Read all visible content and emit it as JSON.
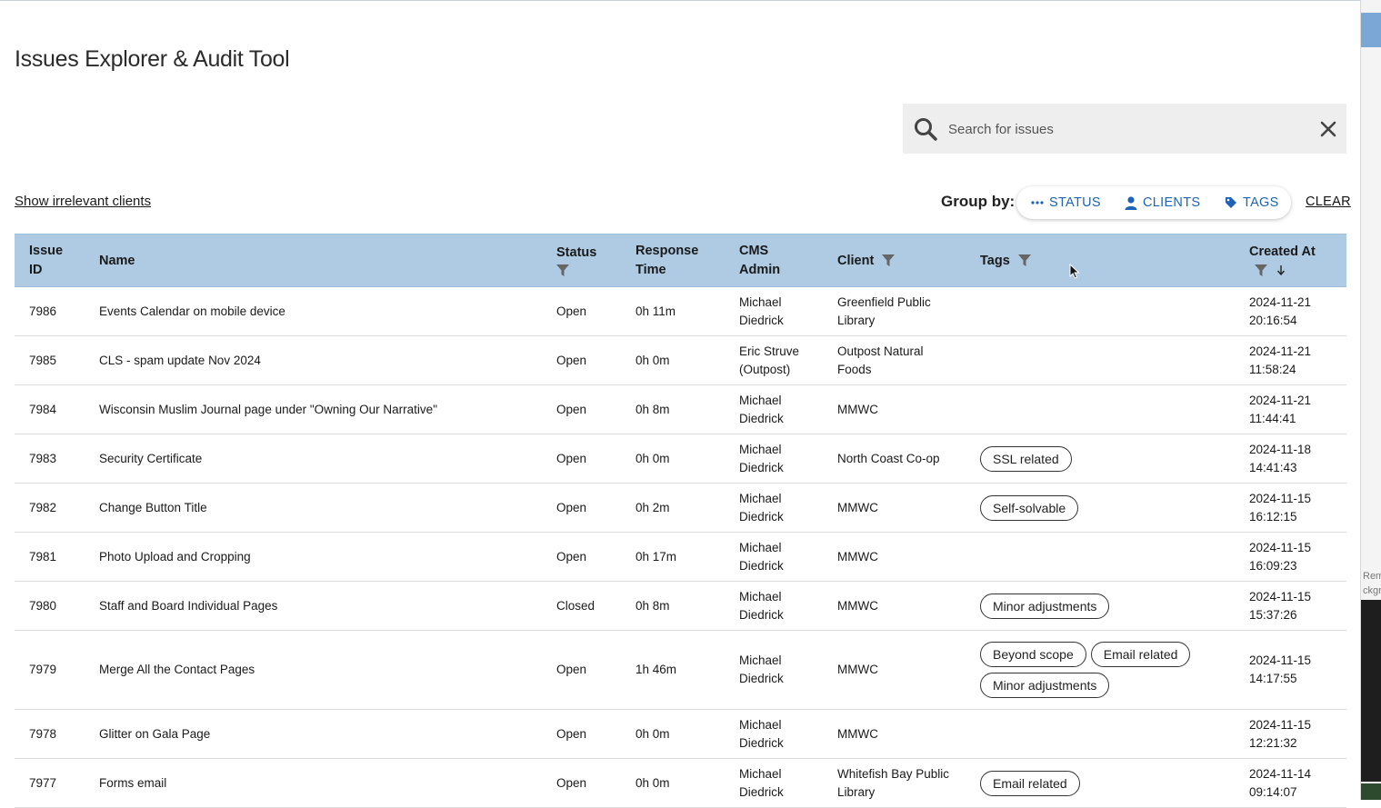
{
  "page": {
    "title": "Issues Explorer & Audit Tool",
    "show_irrelevant_label": "Show irrelevant clients",
    "group_by_label": "Group by:",
    "clear_label": "CLEAR"
  },
  "search": {
    "placeholder": "Search for issues",
    "value": ""
  },
  "group_by": {
    "status_label": "STATUS",
    "clients_label": "CLIENTS",
    "tags_label": "TAGS"
  },
  "table": {
    "headers": {
      "issue_id": "Issue ID",
      "name": "Name",
      "status": "Status",
      "response_time": "Response Time",
      "cms_admin": "CMS Admin",
      "client": "Client",
      "tags": "Tags",
      "created_at": "Created At"
    },
    "rows": [
      {
        "id": "7986",
        "name": "Events Calendar on mobile device",
        "status": "Open",
        "response": "0h 11m",
        "admin_line1": "Michael",
        "admin_line2": "Diedrick",
        "client_line1": "Greenfield Public",
        "client_line2": "Library",
        "tags": [],
        "date": "2024-11-21",
        "time": "20:16:54"
      },
      {
        "id": "7985",
        "name": "CLS - spam update Nov 2024",
        "status": "Open",
        "response": "0h 0m",
        "admin_line1": "Eric Struve",
        "admin_line2": "(Outpost)",
        "client_line1": "Outpost Natural",
        "client_line2": "Foods",
        "tags": [],
        "date": "2024-11-21",
        "time": "11:58:24"
      },
      {
        "id": "7984",
        "name": "Wisconsin Muslim Journal page under \"Owning Our Narrative\"",
        "status": "Open",
        "response": "0h 8m",
        "admin_line1": "Michael",
        "admin_line2": "Diedrick",
        "client_line1": "MMWC",
        "client_line2": "",
        "tags": [],
        "date": "2024-11-21",
        "time": "11:44:41"
      },
      {
        "id": "7983",
        "name": "Security Certificate",
        "status": "Open",
        "response": "0h 0m",
        "admin_line1": "Michael",
        "admin_line2": "Diedrick",
        "client_line1": "North Coast Co-op",
        "client_line2": "",
        "tags": [
          "SSL related"
        ],
        "date": "2024-11-18",
        "time": "14:41:43"
      },
      {
        "id": "7982",
        "name": "Change Button Title",
        "status": "Open",
        "response": "0h 2m",
        "admin_line1": "Michael",
        "admin_line2": "Diedrick",
        "client_line1": "MMWC",
        "client_line2": "",
        "tags": [
          "Self-solvable"
        ],
        "date": "2024-11-15",
        "time": "16:12:15"
      },
      {
        "id": "7981",
        "name": "Photo Upload and Cropping",
        "status": "Open",
        "response": "0h 17m",
        "admin_line1": "Michael",
        "admin_line2": "Diedrick",
        "client_line1": "MMWC",
        "client_line2": "",
        "tags": [],
        "date": "2024-11-15",
        "time": "16:09:23"
      },
      {
        "id": "7980",
        "name": "Staff and Board Individual Pages",
        "status": "Closed",
        "response": "0h 8m",
        "admin_line1": "Michael",
        "admin_line2": "Diedrick",
        "client_line1": "MMWC",
        "client_line2": "",
        "tags": [
          "Minor adjustments"
        ],
        "date": "2024-11-15",
        "time": "15:37:26"
      },
      {
        "id": "7979",
        "name": "Merge All the Contact Pages",
        "status": "Open",
        "response": "1h 46m",
        "admin_line1": "Michael",
        "admin_line2": "Diedrick",
        "client_line1": "MMWC",
        "client_line2": "",
        "tags": [
          "Beyond scope",
          "Email related",
          "Minor adjustments"
        ],
        "date": "2024-11-15",
        "time": "14:17:55"
      },
      {
        "id": "7978",
        "name": "Glitter on Gala Page",
        "status": "Open",
        "response": "0h 0m",
        "admin_line1": "Michael",
        "admin_line2": "Diedrick",
        "client_line1": "MMWC",
        "client_line2": "",
        "tags": [],
        "date": "2024-11-15",
        "time": "12:21:32"
      },
      {
        "id": "7977",
        "name": "Forms email",
        "status": "Open",
        "response": "0h 0m",
        "admin_line1": "Michael",
        "admin_line2": "Diedrick",
        "client_line1": "Whitefish Bay Public",
        "client_line2": "Library",
        "tags": [
          "Email related"
        ],
        "date": "2024-11-14",
        "time": "09:14:07"
      }
    ]
  },
  "colors": {
    "header_bg": "#aecbe3",
    "accent": "#1e63b5",
    "search_bg": "#eeeeee"
  },
  "sidebar_fragment": {
    "line1": "Remo",
    "line2": "ckgr"
  }
}
